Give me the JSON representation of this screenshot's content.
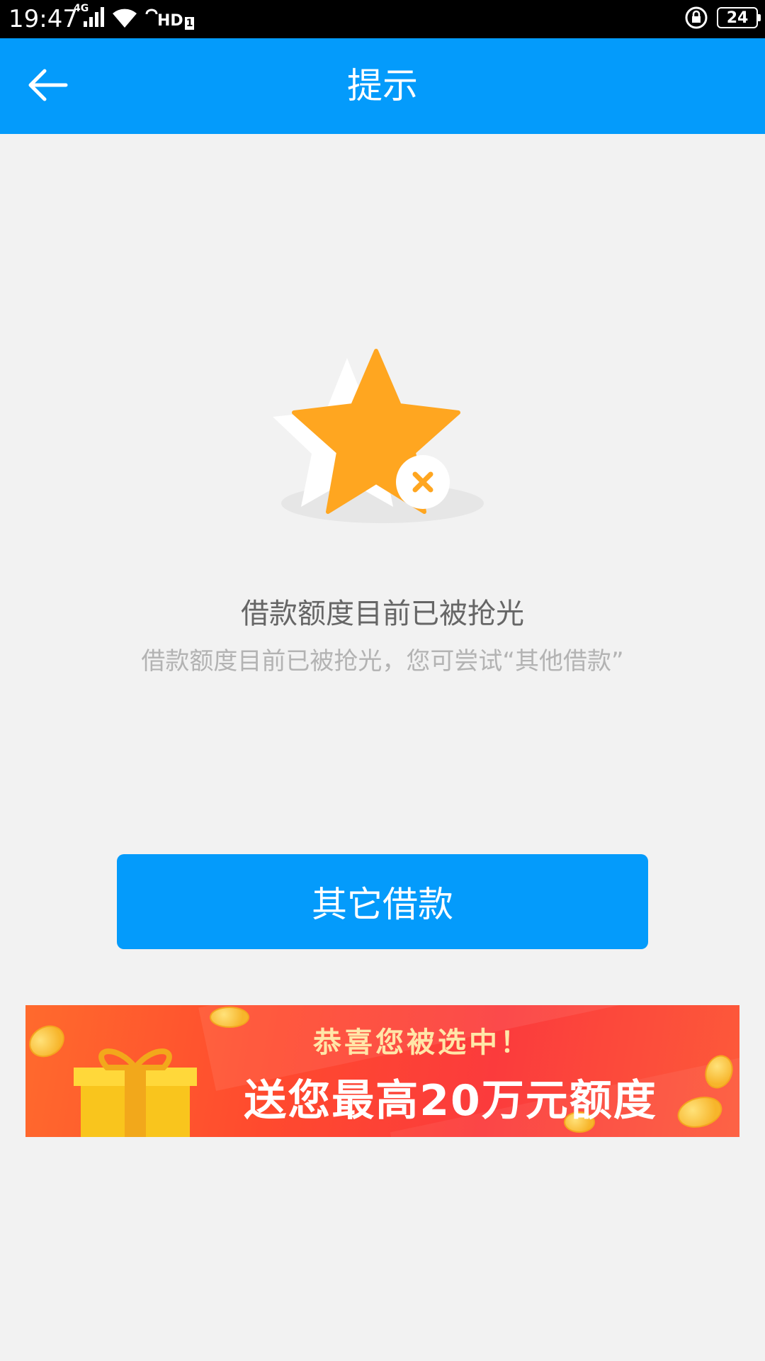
{
  "status_bar": {
    "time": "19:47",
    "network": "4G",
    "hd_label": "HD",
    "hd_sub": "1",
    "battery": "24"
  },
  "app_bar": {
    "title": "提示"
  },
  "notice": {
    "title": "借款额度目前已被抢光",
    "subtitle": "借款额度目前已被抢光，您可尝试“其他借款”"
  },
  "actions": {
    "primary_label": "其它借款"
  },
  "banner": {
    "line1": "恭喜您被选中！",
    "line2": "送您最高20万元额度"
  },
  "colors": {
    "brand_blue": "#049bfb",
    "star_orange": "#ffa620"
  }
}
